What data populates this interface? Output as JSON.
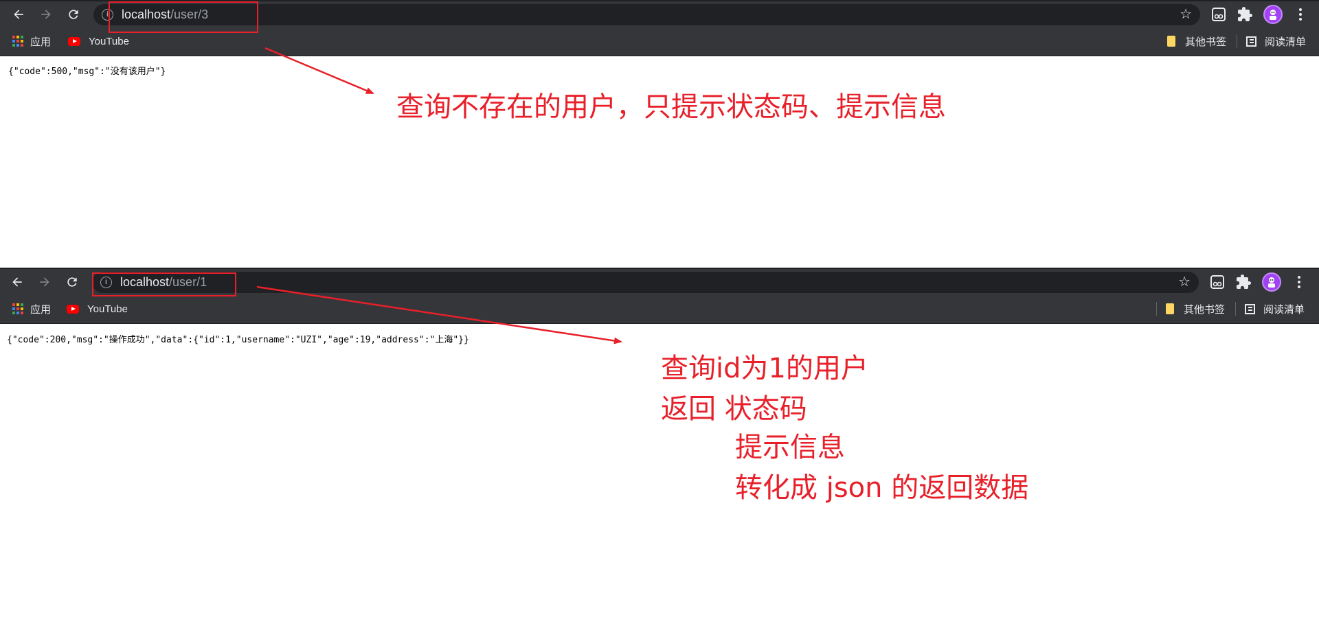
{
  "top_window": {
    "url_host": "localhost",
    "url_path": "/user/3",
    "response": "{\"code\":500,\"msg\":\"没有该用户\"}",
    "bookmarks": {
      "apps": "应用",
      "youtube": "YouTube",
      "other": "其他书签",
      "reading": "阅读清单"
    }
  },
  "bottom_window": {
    "url_host": "localhost",
    "url_path": "/user/1",
    "response": "{\"code\":200,\"msg\":\"操作成功\",\"data\":{\"id\":1,\"username\":\"UZI\",\"age\":19,\"address\":\"上海\"}}",
    "bookmarks": {
      "apps": "应用",
      "youtube": "YouTube",
      "other": "其他书签",
      "reading": "阅读清单"
    }
  },
  "annotations": {
    "top": "查询不存在的用户，只提示状态码、提示信息",
    "bottom_lines": [
      "查询id为1的用户",
      "返回 状态码",
      "提示信息",
      "转化成 json 的返回数据"
    ]
  },
  "colors": {
    "annotation": "#e8202a",
    "toolbar": "#35363a",
    "omnibox": "#202124",
    "avatar": "#a142f4",
    "folder": "#fdd663",
    "youtube": "#ff0000"
  },
  "icons": [
    "back-arrow-icon",
    "forward-arrow-icon",
    "reload-icon",
    "info-icon",
    "star-icon",
    "reading-mode-icon",
    "extensions-puzzle-icon",
    "profile-avatar-icon",
    "kebab-menu-icon",
    "apps-grid-icon",
    "youtube-icon",
    "bookmark-folder-icon",
    "reading-list-icon"
  ]
}
